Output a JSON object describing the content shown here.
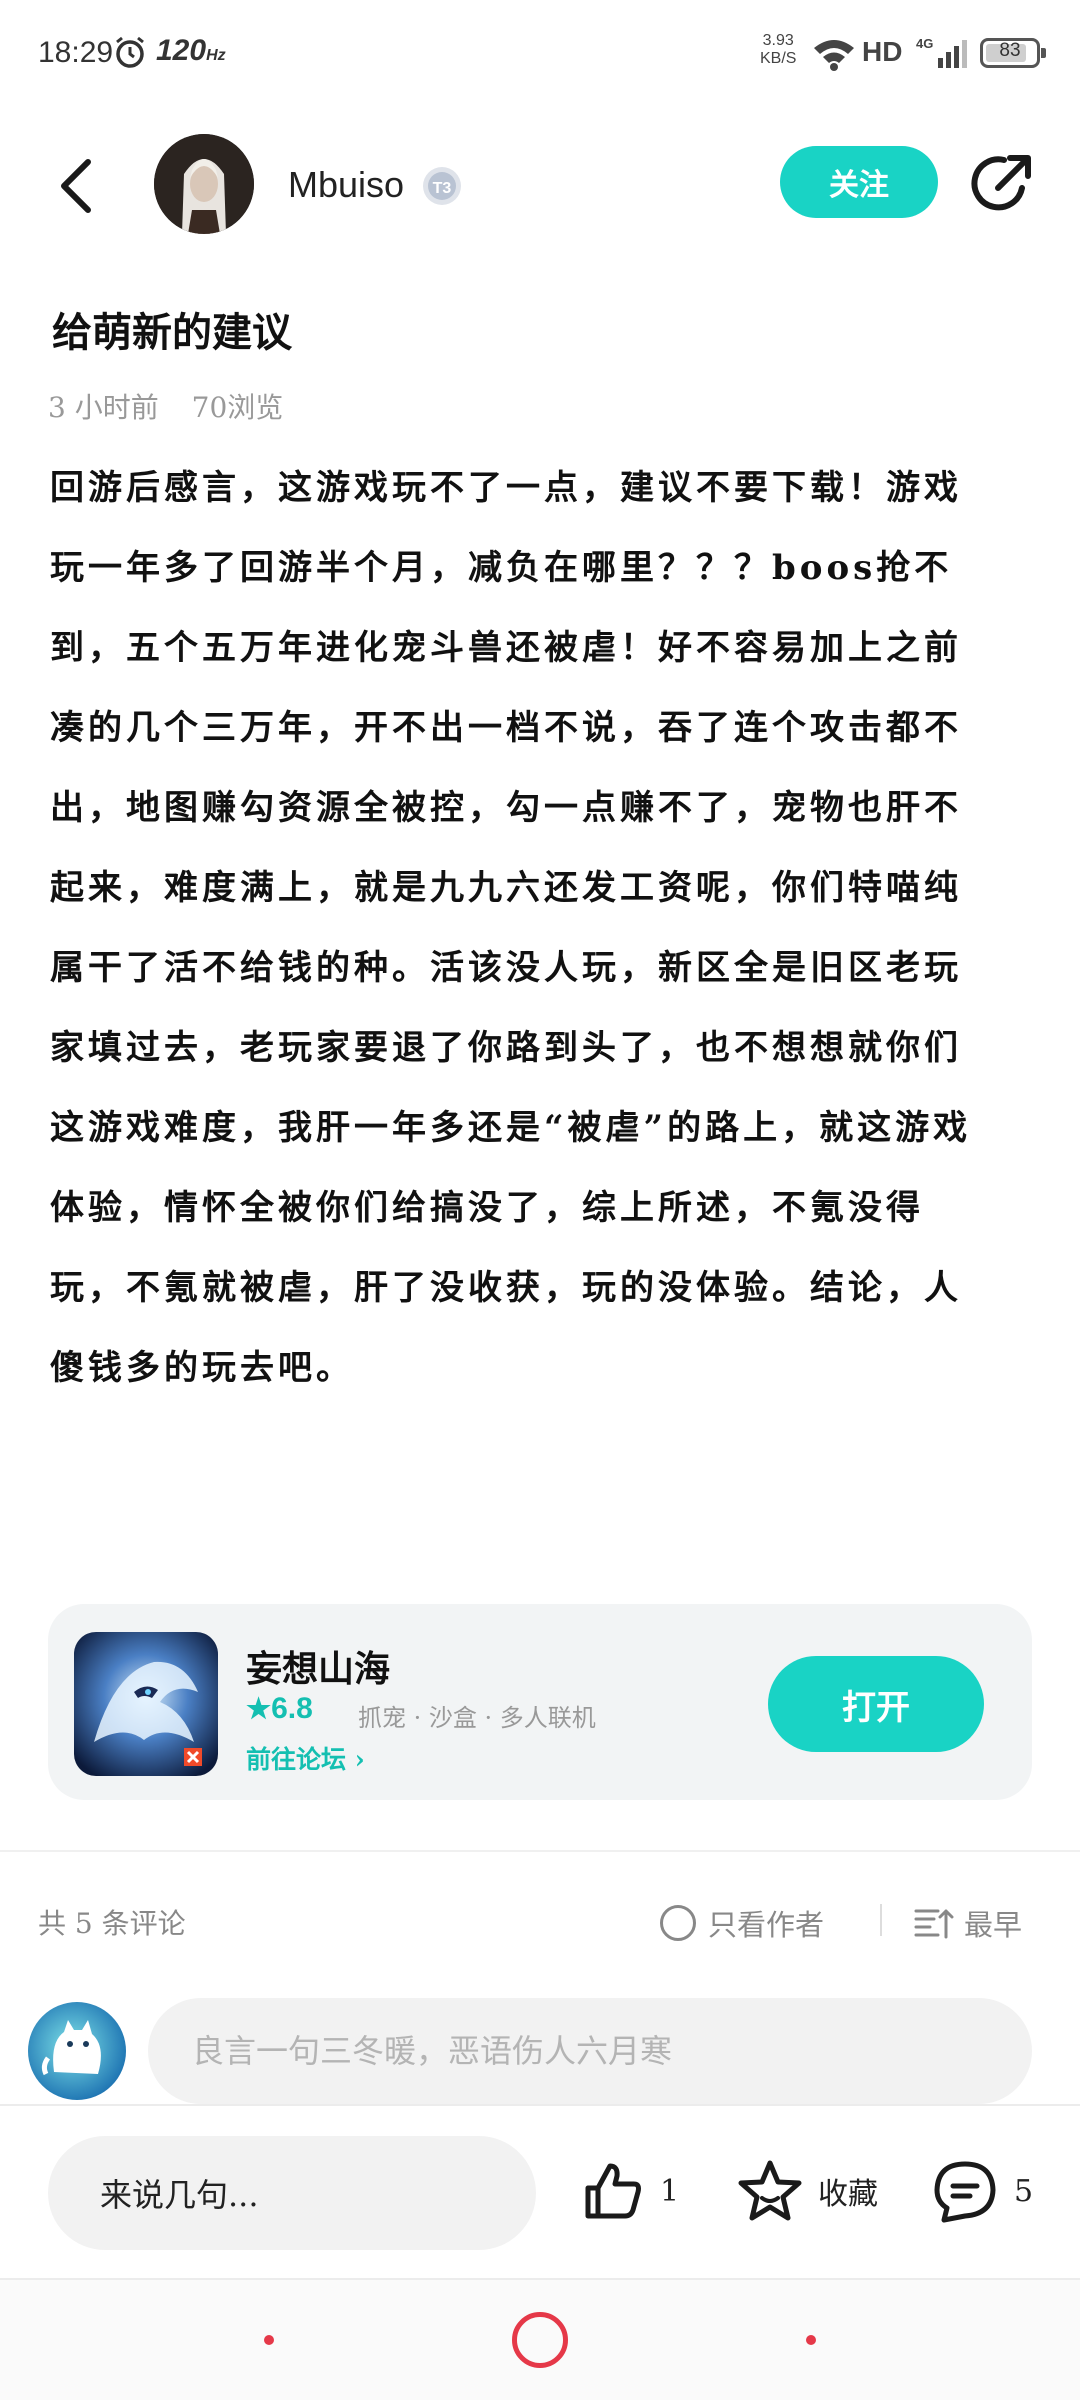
{
  "status_bar": {
    "time": "18:29",
    "refresh_rate": "120",
    "refresh_unit": "Hz",
    "net_speed_value": "3.93",
    "net_speed_unit": "KB/S",
    "hd_label": "HD",
    "network_label": "4G",
    "battery": "83",
    "battery_level": 0.83
  },
  "header": {
    "username": "Mbuiso",
    "level_badge": "T3",
    "follow_label": "关注"
  },
  "post": {
    "title": "给萌新的建议",
    "time_ago": "3 小时前",
    "views": "70浏览",
    "body": "回游后感言，这游戏玩不了一点，建议不要下载！游戏玩一年多了回游半个月，减负在哪里？？？boos抢不到，五个五万年进化宠斗兽还被虐！好不容易加上之前凑的几个三万年，开不出一档不说，吞了连个攻击都不出，地图赚勾资源全被控，勾一点赚不了，宠物也肝不起来，难度满上，就是九九六还发工资呢，你们特喵纯属干了活不给钱的种。活该没人玩，新区全是旧区老玩家填过去，老玩家要退了你路到头了，也不想想就你们这游戏难度，我肝一年多还是“被虐”的路上，就这游戏体验，情怀全被你们给搞没了，综上所述，不氪没得玩，不氪就被虐，肝了没收获，玩的没体验。结论，人傻钱多的玩去吧。"
  },
  "game_card": {
    "name": "妄想山海",
    "rating": "6.8",
    "tags": "抓宠 · 沙盒 · 多人联机",
    "forum_link": "前往论坛",
    "open_label": "打开"
  },
  "comments": {
    "count_label": "共 5 条评论",
    "author_only_label": "只看作者",
    "sort_label": "最早",
    "input_placeholder": "良言一句三冬暖，恶语伤人六月寒"
  },
  "bottom_bar": {
    "reply_placeholder": "来说几句...",
    "likes": "1",
    "favorite_label": "收藏",
    "comments": "5"
  },
  "colors": {
    "accent": "#19d3c5",
    "nav_accent": "#e53848"
  }
}
